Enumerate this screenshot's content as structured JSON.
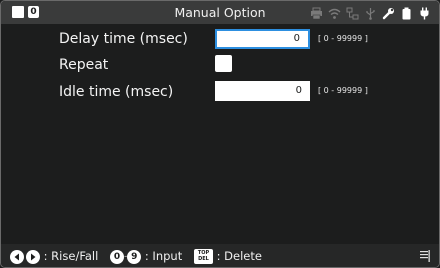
{
  "window": {
    "title": "Manual Option",
    "badge": "0"
  },
  "status_icons": [
    "printer-icon",
    "wifi-icon",
    "network-icon",
    "usb-icon",
    "wrench-icon",
    "battery-icon",
    "power-plug-icon"
  ],
  "form": {
    "delay": {
      "label": "Delay time (msec)",
      "value": "0",
      "range": "[ 0 - 99999 ]"
    },
    "repeat": {
      "label": "Repeat",
      "checked": false
    },
    "idle": {
      "label": "Idle time (msec)",
      "value": "0",
      "range": "[ 0 - 99999 ]"
    }
  },
  "footer": {
    "rise_fall": ": Rise/Fall",
    "key_0": "0",
    "key_sep": "-",
    "key_9": "9",
    "input": ": Input",
    "top_del_top": "TOP",
    "top_del_bottom": "DEL",
    "delete": ": Delete"
  },
  "colors": {
    "background": "#1c1d1d",
    "titlebar": "#3a3b3b",
    "focus": "#2d8fe0"
  }
}
